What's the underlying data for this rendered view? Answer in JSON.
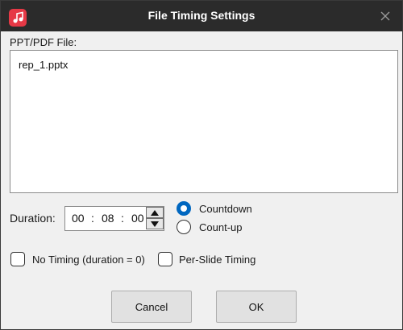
{
  "window": {
    "title": "File Timing Settings",
    "app_icon": "music-note-icon",
    "close_icon": "close-icon"
  },
  "file_section": {
    "label": "PPT/PDF File:",
    "files": [
      "rep_1.pptx"
    ]
  },
  "duration": {
    "label": "Duration:",
    "hours": "00",
    "minutes": "08",
    "seconds": "00",
    "separator": ":"
  },
  "mode": {
    "countdown_label": "Countdown",
    "countup_label": "Count-up",
    "selected": "Countdown"
  },
  "options": {
    "no_timing_label": "No Timing (duration = 0)",
    "no_timing_checked": false,
    "per_slide_label": "Per-Slide Timing",
    "per_slide_checked": false
  },
  "buttons": {
    "cancel": "Cancel",
    "ok": "OK"
  },
  "colors": {
    "titlebar": "#2b2b2b",
    "accent": "#0067c0",
    "app_icon_bg": "#e63946"
  }
}
